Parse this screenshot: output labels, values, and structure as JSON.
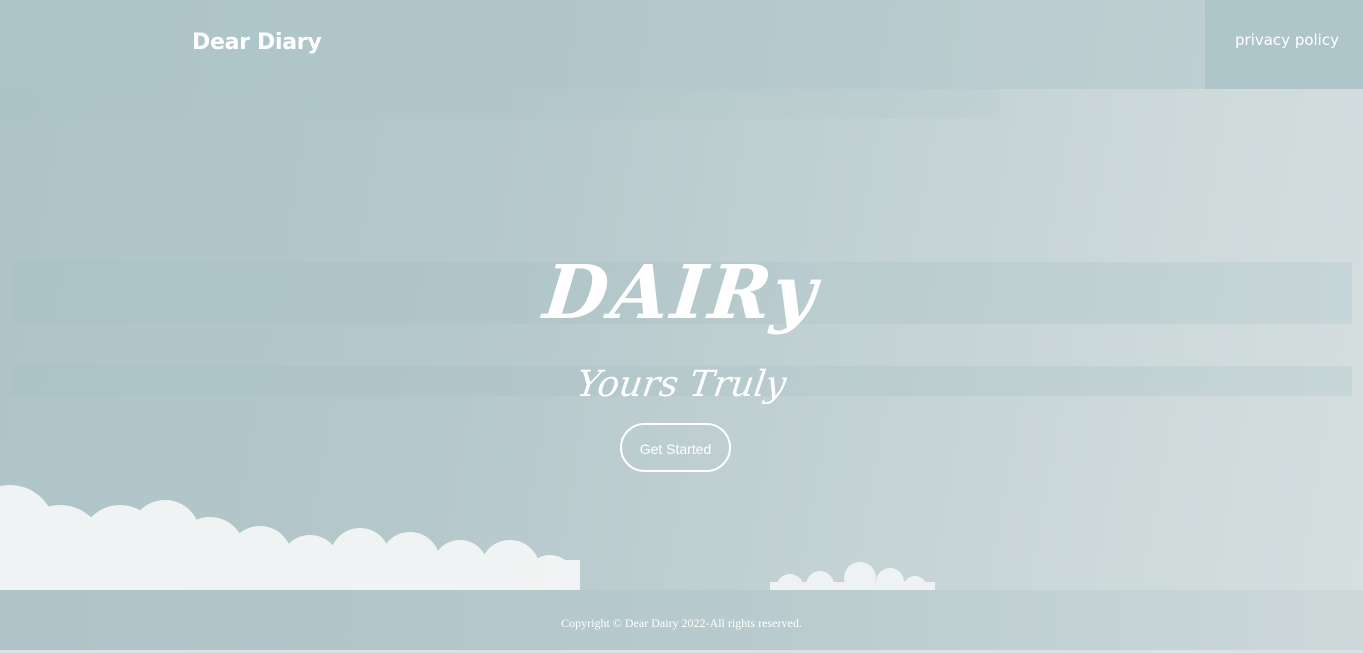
{
  "header": {
    "brand": "Dear Diary",
    "privacy_link": "privacy policy"
  },
  "hero": {
    "title": "DAIRy",
    "subtitle": "Yours Truly",
    "cta_label": "Get Started"
  },
  "footer": {
    "copyright": "Copyright © Dear Dairy 2022-All rights reserved."
  },
  "colors": {
    "sky_left": "#aec4c8",
    "sky_right": "#d6dfe0",
    "text": "#ffffff",
    "cloud": "#f4f6f6"
  }
}
